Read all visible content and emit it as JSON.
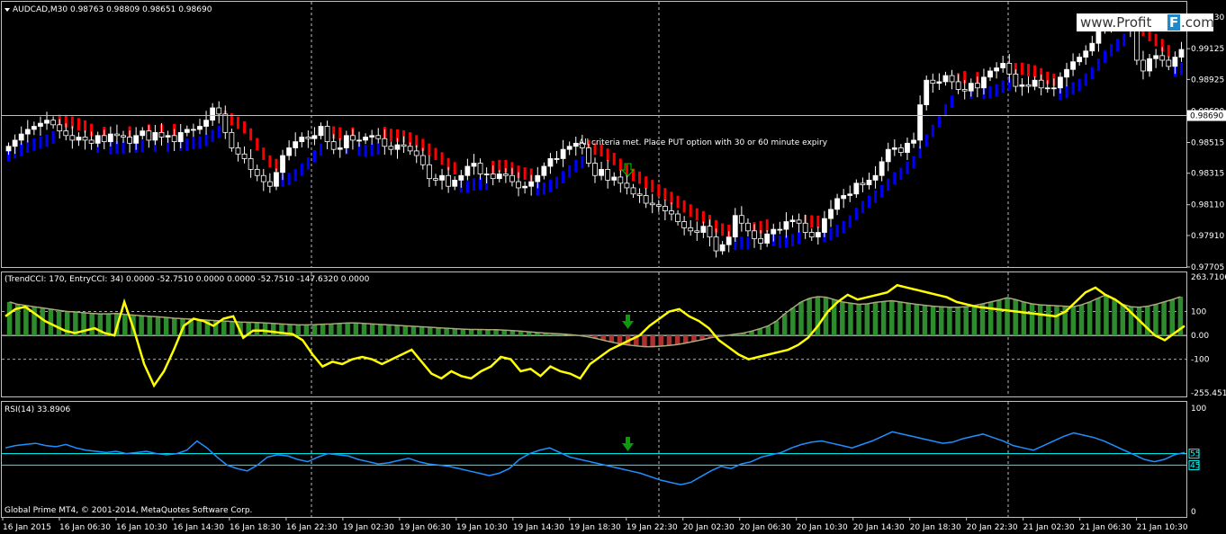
{
  "symbol_header": "AUDCAD,M30  0.98763 0.98809 0.98651 0.98690",
  "watermark": {
    "prefix": "www.Profit",
    "badge": "F",
    "suffix": ".com"
  },
  "annotation": "All criteria met. Place PUT option with 30 or 60 minute expiry",
  "cci_header": "(TrendCCI: 170, EntryCCI: 34)  0.0000 -52.7510 0.0000 0.0000 -52.7510 -147.6320 0.0000",
  "rsi_header": "RSI(14) 33.8906",
  "copyright": "Global Prime MT4, © 2001-2014, MetaQuotes Software Corp.",
  "colors": {
    "background": "#000000",
    "bull_candle": "#ffffff",
    "bear_candle": "#000000",
    "trend_up": "#0000ff",
    "trend_down": "#ff0000",
    "cci_hist_pos": "#2e8b2e",
    "cci_hist_neg": "#b03030",
    "cci_entry": "#ffff00",
    "cci_trend_line": "#a8a878",
    "rsi_line": "#1e90ff",
    "rsi_levels": "#00ffff",
    "arrow": "#00aa00"
  },
  "chart_data": [
    {
      "type": "candlestick",
      "title": "AUDCAD,M30",
      "ohlc_header": "0.98763 0.98809 0.98651 0.98690",
      "y_ticks": [
        "0.99130",
        "0.99125",
        "0.98925",
        "0.98690",
        "0.98515",
        "0.98315",
        "0.98110",
        "0.97910",
        "0.97705"
      ],
      "y_tick_values": [
        0.9933,
        0.99125,
        0.98925,
        0.9872,
        0.98515,
        0.98315,
        0.9811,
        0.9791,
        0.97705
      ],
      "last_price_label": "0.98690",
      "last_price": 0.9869,
      "ylim": [
        0.97705,
        0.9943
      ],
      "close_series": [
        0.9849,
        0.9853,
        0.9857,
        0.986,
        0.9862,
        0.9864,
        0.9866,
        0.9863,
        0.9859,
        0.9856,
        0.9853,
        0.9855,
        0.9853,
        0.9851,
        0.9856,
        0.9852,
        0.9857,
        0.9856,
        0.9855,
        0.9851,
        0.9856,
        0.9859,
        0.9853,
        0.9858,
        0.9855,
        0.9856,
        0.9852,
        0.9858,
        0.986,
        0.986,
        0.9862,
        0.9866,
        0.9874,
        0.987,
        0.9858,
        0.9848,
        0.9844,
        0.9841,
        0.9834,
        0.983,
        0.9826,
        0.9823,
        0.9832,
        0.9843,
        0.9848,
        0.9852,
        0.9855,
        0.9854,
        0.9856,
        0.9862,
        0.9852,
        0.9847,
        0.9848,
        0.9856,
        0.9853,
        0.9853,
        0.9855,
        0.9856,
        0.9854,
        0.9849,
        0.9847,
        0.985,
        0.9849,
        0.9846,
        0.9843,
        0.9837,
        0.9828,
        0.9827,
        0.983,
        0.9823,
        0.9827,
        0.983,
        0.9836,
        0.9838,
        0.9831,
        0.9831,
        0.9828,
        0.9831,
        0.983,
        0.9826,
        0.9822,
        0.9823,
        0.9826,
        0.983,
        0.9836,
        0.9841,
        0.9841,
        0.9847,
        0.9849,
        0.9851,
        0.9848,
        0.9838,
        0.983,
        0.9834,
        0.9827,
        0.9829,
        0.9825,
        0.9822,
        0.9818,
        0.9817,
        0.9812,
        0.9811,
        0.981,
        0.9807,
        0.9805,
        0.98,
        0.9796,
        0.9794,
        0.9793,
        0.9797,
        0.979,
        0.9781,
        0.9785,
        0.979,
        0.9804,
        0.9799,
        0.9794,
        0.9789,
        0.9786,
        0.9792,
        0.9795,
        0.9795,
        0.98,
        0.9801,
        0.9799,
        0.9793,
        0.979,
        0.9793,
        0.9802,
        0.9808,
        0.9815,
        0.9817,
        0.9818,
        0.9825,
        0.9824,
        0.9827,
        0.983,
        0.9839,
        0.9847,
        0.9848,
        0.9845,
        0.9851,
        0.9853,
        0.9876,
        0.9892,
        0.989,
        0.9891,
        0.9895,
        0.9891,
        0.9886,
        0.9885,
        0.989,
        0.9887,
        0.9894,
        0.9898,
        0.99,
        0.9903,
        0.9896,
        0.9888,
        0.9889,
        0.9888,
        0.9892,
        0.9887,
        0.9887,
        0.9887,
        0.9894,
        0.9899,
        0.9904,
        0.9907,
        0.9911,
        0.9916,
        0.9926,
        0.9929,
        0.993,
        0.9928,
        0.9929,
        0.9925,
        0.9905,
        0.9898,
        0.9906,
        0.9908,
        0.9905,
        0.9901,
        0.9907,
        0.9912
      ]
    },
    {
      "type": "bar",
      "title": "(TrendCCI: 170, EntryCCI: 34)",
      "y_ticks": [
        "263.7106",
        "100",
        "0.00",
        "-100",
        "-255.4512"
      ],
      "y_tick_values": [
        263.7106,
        100,
        0,
        -100,
        -255.4512
      ],
      "ylim": [
        -255.4512,
        263.7106
      ],
      "levels": [
        100,
        0,
        -100
      ],
      "series": [
        {
          "name": "TrendCCI",
          "values": [
            140,
            130,
            125,
            120,
            115,
            110,
            105,
            100,
            98,
            95,
            92,
            90,
            90,
            92,
            88,
            85,
            82,
            80,
            78,
            75,
            72,
            70,
            68,
            66,
            64,
            62,
            60,
            58,
            56,
            55,
            54,
            52,
            50,
            48,
            46,
            44,
            44,
            45,
            47,
            48,
            50,
            52,
            52,
            50,
            48,
            46,
            44,
            42,
            40,
            38,
            36,
            34,
            32,
            30,
            28,
            26,
            25,
            25,
            24,
            24,
            22,
            20,
            18,
            15,
            12,
            10,
            8,
            6,
            3,
            0,
            -5,
            -12,
            -20,
            -28,
            -35,
            -40,
            -44,
            -47,
            -47,
            -45,
            -42,
            -38,
            -32,
            -25,
            -18,
            -10,
            -4,
            0,
            5,
            10,
            18,
            28,
            40,
            60,
            90,
            115,
            140,
            155,
            162,
            160,
            150,
            140,
            135,
            130,
            132,
            138,
            142,
            145,
            140,
            135,
            130,
            126,
            122,
            120,
            118,
            118,
            120,
            125,
            132,
            140,
            148,
            158,
            150,
            140,
            132,
            128,
            126,
            124,
            122,
            120,
            128,
            140,
            156,
            170,
            150,
            130,
            120,
            118,
            122,
            130,
            140,
            150,
            162
          ]
        },
        {
          "name": "EntryCCI",
          "values": [
            80,
            110,
            120,
            90,
            60,
            40,
            20,
            10,
            20,
            30,
            10,
            0,
            140,
            20,
            -120,
            -210,
            -150,
            -60,
            40,
            70,
            60,
            40,
            70,
            80,
            -10,
            20,
            20,
            15,
            10,
            5,
            -20,
            -80,
            -130,
            -110,
            -120,
            -100,
            -90,
            -100,
            -120,
            -100,
            -80,
            -60,
            -110,
            -160,
            -180,
            -150,
            -170,
            -180,
            -150,
            -130,
            -90,
            -100,
            -150,
            -140,
            -170,
            -130,
            -150,
            -160,
            -180,
            -120,
            -90,
            -60,
            -40,
            -20,
            0,
            40,
            70,
            100,
            110,
            80,
            60,
            30,
            -20,
            -50,
            -80,
            -100,
            -90,
            -80,
            -70,
            -60,
            -40,
            -10,
            40,
            100,
            140,
            170,
            150,
            160,
            170,
            180,
            210,
            200,
            190,
            180,
            170,
            160,
            140,
            130,
            120,
            115,
            110,
            105,
            100,
            95,
            90,
            85,
            80,
            100,
            140,
            180,
            200,
            170,
            150,
            120,
            80,
            40,
            0,
            -20,
            10,
            40
          ]
        }
      ]
    },
    {
      "type": "line",
      "title": "RSI(14)",
      "subtitle": "33.8906",
      "y_ticks": [
        "100",
        "55",
        "45",
        "0"
      ],
      "y_tick_values": [
        100,
        55,
        45,
        0
      ],
      "ylim": [
        0,
        100
      ],
      "levels": [
        55,
        45
      ],
      "series": [
        {
          "name": "RSI(14)",
          "values": [
            60,
            62,
            63,
            64,
            62,
            61,
            63,
            60,
            58,
            57,
            56,
            57,
            55,
            56,
            57,
            55,
            54,
            55,
            58,
            66,
            60,
            52,
            45,
            42,
            40,
            45,
            52,
            54,
            53,
            50,
            48,
            52,
            55,
            54,
            53,
            50,
            48,
            46,
            47,
            49,
            51,
            48,
            46,
            45,
            44,
            42,
            40,
            38,
            36,
            38,
            42,
            50,
            55,
            58,
            60,
            56,
            52,
            50,
            48,
            46,
            44,
            42,
            40,
            38,
            35,
            32,
            30,
            28,
            30,
            35,
            40,
            44,
            42,
            46,
            48,
            52,
            54,
            56,
            60,
            63,
            65,
            66,
            64,
            62,
            60,
            63,
            66,
            70,
            74,
            72,
            70,
            68,
            66,
            64,
            65,
            68,
            70,
            72,
            69,
            66,
            62,
            60,
            58,
            62,
            66,
            70,
            73,
            71,
            69,
            66,
            62,
            58,
            54,
            50,
            48,
            50,
            54,
            56
          ]
        }
      ],
      "xlabel": "",
      "x_ticks": [
        "16 Jan 2015",
        "16 Jan 06:30",
        "16 Jan 10:30",
        "16 Jan 14:30",
        "16 Jan 18:30",
        "16 Jan 22:30",
        "19 Jan 02:30",
        "19 Jan 06:30",
        "19 Jan 10:30",
        "19 Jan 14:30",
        "19 Jan 18:30",
        "19 Jan 22:30",
        "20 Jan 02:30",
        "20 Jan 06:30",
        "20 Jan 10:30",
        "20 Jan 14:30",
        "20 Jan 18:30",
        "20 Jan 22:30",
        "21 Jan 02:30",
        "21 Jan 06:30",
        "21 Jan 10:30"
      ]
    }
  ]
}
